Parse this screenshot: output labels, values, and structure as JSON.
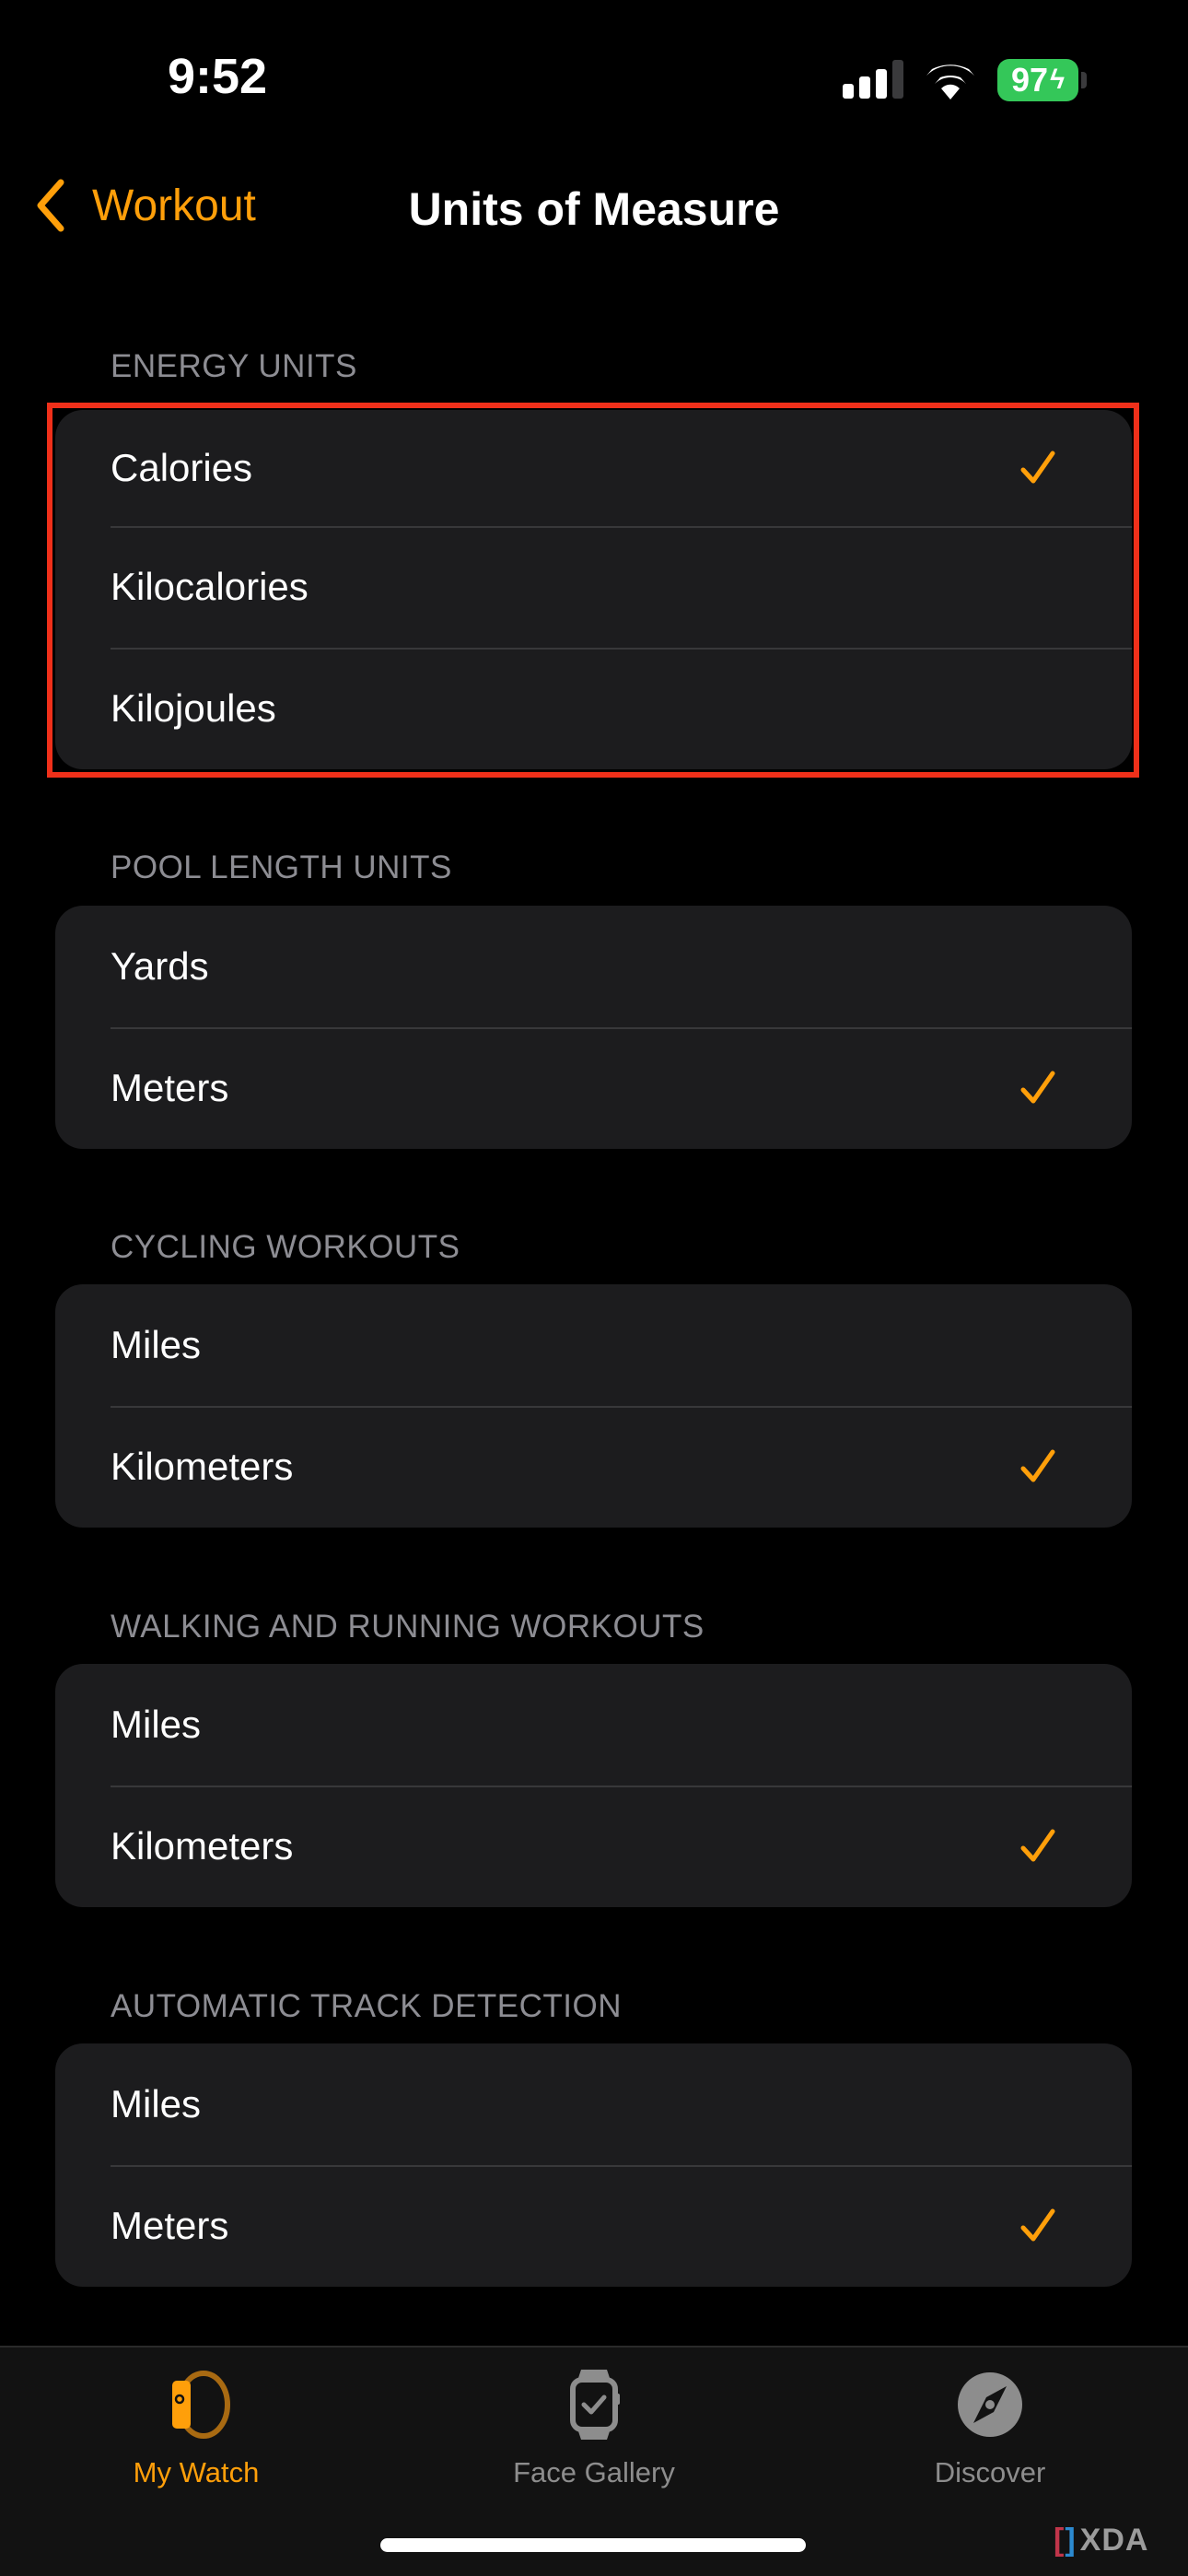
{
  "status_bar": {
    "time": "9:52",
    "battery_percent": "97",
    "battery_charging_icon": "bolt-icon",
    "signal_bars_active": 3,
    "signal_bars_total": 4,
    "wifi_icon": "wifi-icon"
  },
  "nav": {
    "back_label": "Workout",
    "back_icon": "chevron-left-icon",
    "title": "Units of Measure"
  },
  "colors": {
    "accent": "#ff9f0a",
    "card_background": "#1c1c1e",
    "section_header": "#8d8d93",
    "highlight_annotation": "#f0301a",
    "battery": "#34c759"
  },
  "sections": [
    {
      "header": "ENERGY UNITS",
      "highlighted": true,
      "options": [
        {
          "label": "Calories",
          "selected": true
        },
        {
          "label": "Kilocalories",
          "selected": false
        },
        {
          "label": "Kilojoules",
          "selected": false
        }
      ]
    },
    {
      "header": "POOL LENGTH UNITS",
      "options": [
        {
          "label": "Yards",
          "selected": false
        },
        {
          "label": "Meters",
          "selected": true
        }
      ]
    },
    {
      "header": "CYCLING WORKOUTS",
      "options": [
        {
          "label": "Miles",
          "selected": false
        },
        {
          "label": "Kilometers",
          "selected": true
        }
      ]
    },
    {
      "header": "WALKING AND RUNNING WORKOUTS",
      "options": [
        {
          "label": "Miles",
          "selected": false
        },
        {
          "label": "Kilometers",
          "selected": true
        }
      ]
    },
    {
      "header": "AUTOMATIC TRACK DETECTION",
      "options": [
        {
          "label": "Miles",
          "selected": false
        },
        {
          "label": "Meters",
          "selected": true
        }
      ]
    }
  ],
  "tab_bar": {
    "tabs": [
      {
        "label": "My Watch",
        "icon": "watch-side-icon",
        "active": true
      },
      {
        "label": "Face Gallery",
        "icon": "watch-face-icon",
        "active": false
      },
      {
        "label": "Discover",
        "icon": "compass-icon",
        "active": false
      }
    ]
  },
  "watermark": {
    "text": "XDA"
  }
}
